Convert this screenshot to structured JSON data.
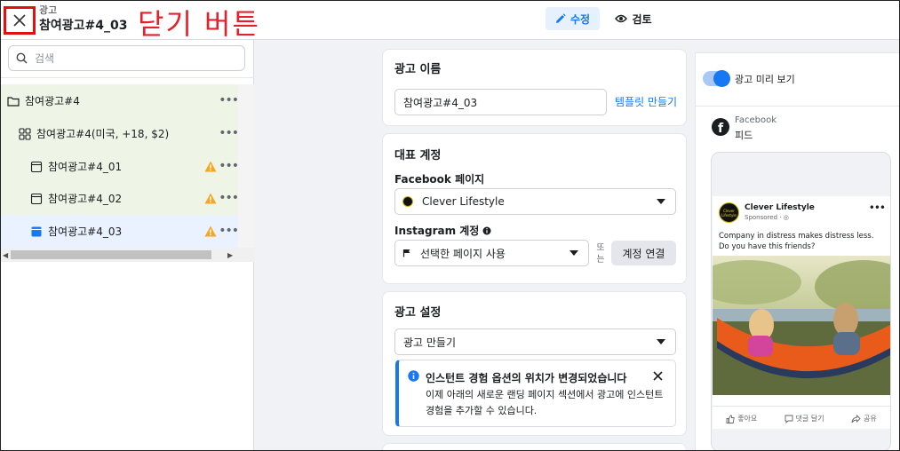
{
  "header": {
    "breadcrumb_small": "광고",
    "ad_title": "참여광고#4_03",
    "annotation": "닫기 버튼",
    "tab_edit": "수정",
    "tab_review": "검토"
  },
  "sidebar": {
    "search_placeholder": "검색",
    "tree": [
      {
        "label": "참여광고#4",
        "level": "campaign",
        "warning": false,
        "selected": false
      },
      {
        "label": "참여광고#4(미국, +18, $2)",
        "level": "adset",
        "warning": false,
        "selected": false
      },
      {
        "label": "참여광고#4_01",
        "level": "ad",
        "warning": true,
        "selected": false
      },
      {
        "label": "참여광고#4_02",
        "level": "ad",
        "warning": true,
        "selected": false
      },
      {
        "label": "참여광고#4_03",
        "level": "ad",
        "warning": true,
        "selected": true
      }
    ]
  },
  "ad_name_card": {
    "title": "광고 이름",
    "value": "참여광고#4_03",
    "template_link": "템플릿 만들기"
  },
  "identity_card": {
    "title": "대표 계정",
    "facebook_label": "Facebook 페이지",
    "facebook_value": "Clever Lifestyle",
    "instagram_label": "Instagram 계정",
    "instagram_value": "선택한 페이지 사용",
    "or_text": "또는",
    "connect_button": "계정 연결"
  },
  "settings_card": {
    "title": "광고 설정",
    "select_value": "광고 만들기",
    "notice_title": "인스턴트 경험 옵션의 위치가 변경되었습니다",
    "notice_body": "이제 아래의 새로운 랜딩 페이지 섹션에서 광고에 인스턴트 경험을 추가할 수 있습니다."
  },
  "preview": {
    "toggle_label": "광고 미리 보기",
    "platform": "Facebook",
    "placement": "피드",
    "post": {
      "page_name": "Clever Lifestyle",
      "sponsored": "Sponsored · ",
      "avatar_text": "Clever Lifestyle",
      "text": "Company in distress makes distress less. Do you have this friends?",
      "like": "좋아요",
      "comment": "댓글 달기",
      "share": "공유"
    }
  },
  "colors": {
    "accent": "#1877f2",
    "warning": "#f5a623",
    "annotation": "#e3212b",
    "selected_bg": "#e9f2fe",
    "tree_bg": "#eef5e6"
  }
}
